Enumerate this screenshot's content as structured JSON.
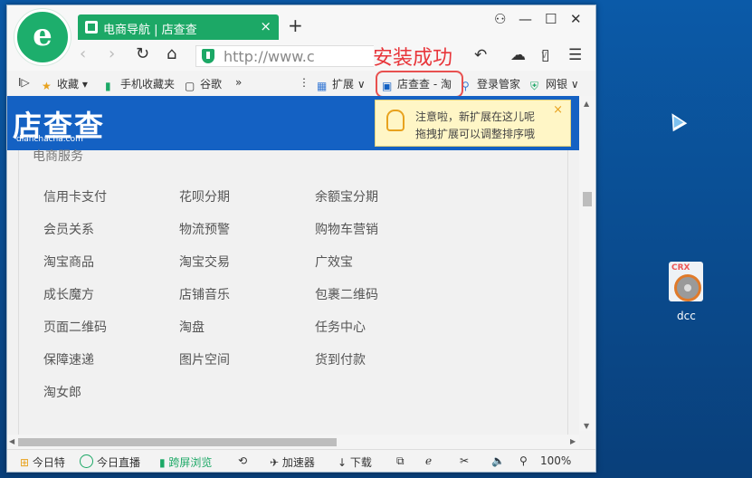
{
  "browser": {
    "tab_title": "电商导航 | 店查查",
    "tab_close": "×",
    "new_tab": "+",
    "window_controls": [
      "⚇",
      "—",
      "☐",
      "✕"
    ],
    "url": "http://www.c",
    "install_success": "安装成功"
  },
  "bookmarks": {
    "toggle": "I▷",
    "items": [
      "收藏",
      "手机收藏夹",
      "谷歌"
    ],
    "more": "»",
    "extensions": "扩展",
    "ext_active": "店查查 - 淘",
    "login_manager": "登录管家",
    "ebank": "网银"
  },
  "page": {
    "brand": "店查查",
    "brand_domain": "dianchacha.com",
    "section_title": "电商服务",
    "links": [
      [
        "信用卡支付",
        "花呗分期",
        "余额宝分期"
      ],
      [
        "会员关系",
        "物流预警",
        "购物车营销"
      ],
      [
        "淘宝商品",
        "淘宝交易",
        "广效宝"
      ],
      [
        "成长魔方",
        "店铺音乐",
        "包裹二维码"
      ],
      [
        "页面二维码",
        "淘盘",
        "任务中心"
      ],
      [
        "保障速递",
        "图片空间",
        "货到付款"
      ],
      [
        "淘女郎"
      ]
    ],
    "tip_line1": "注意啦，新扩展在这儿呢",
    "tip_line2": "拖拽扩展可以调整排序哦",
    "tip_close": "×"
  },
  "statusbar": {
    "today_special": "今日特",
    "today_live": "今日直播",
    "cross_screen": "跨屏浏览",
    "accelerator": "加速器",
    "download": "下载",
    "zoom": "100%"
  },
  "desktop": {
    "file_label": "dcc",
    "file_badge": "CRX"
  },
  "colors": {
    "accent_green": "#1ca866",
    "banner_blue": "#1461c3",
    "success_red": "#e8363b"
  }
}
